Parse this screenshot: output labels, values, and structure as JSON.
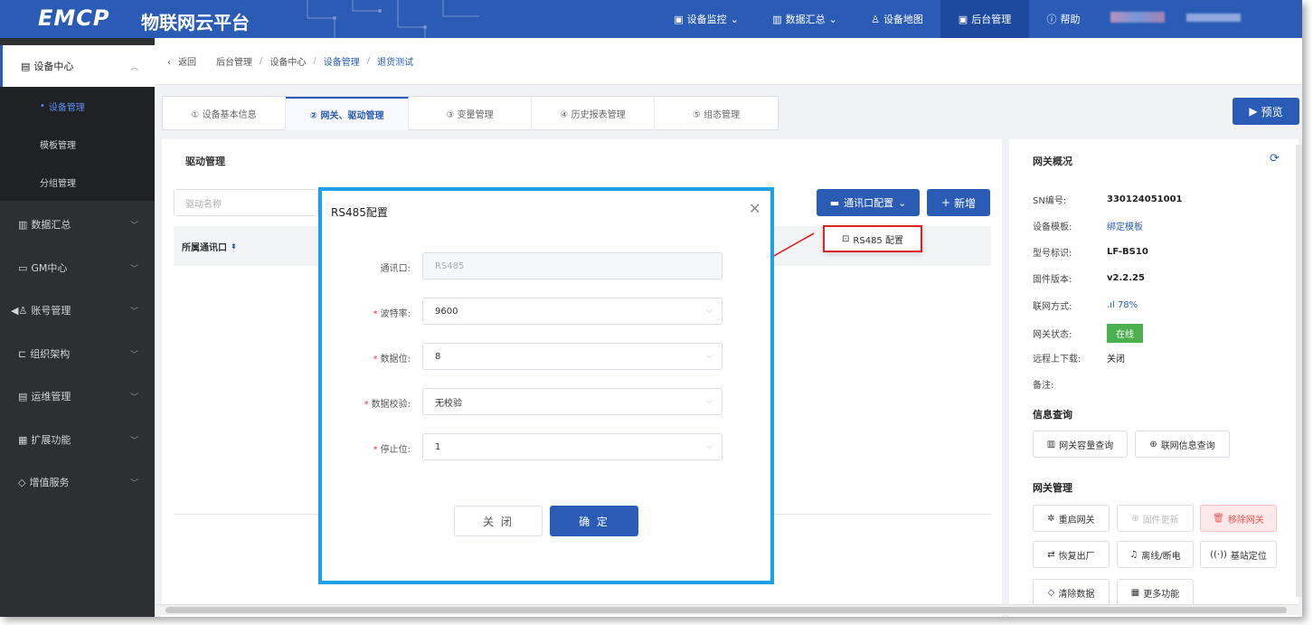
{
  "app": {
    "logo": "EMCP",
    "title": "物联网云平台"
  },
  "topnav": [
    {
      "label": "设备监控",
      "icon": "monitor-icon"
    },
    {
      "label": "数据汇总",
      "icon": "chart-icon"
    },
    {
      "label": "设备地图",
      "icon": "user-icon"
    },
    {
      "label": "后台管理",
      "icon": "monitor-icon",
      "active": true
    },
    {
      "label": "帮助",
      "icon": "help-icon"
    }
  ],
  "sidebar": {
    "device_center": "设备中心",
    "subs": [
      "设备管理",
      "模板管理",
      "分组管理"
    ],
    "groups": [
      "数据汇总",
      "GM中心",
      "账号管理",
      "组织架构",
      "运维管理",
      "扩展功能",
      "增值服务"
    ]
  },
  "breadcrumb": {
    "back": "返回",
    "items": [
      "后台管理",
      "设备中心",
      "设备管理",
      "退货测试"
    ]
  },
  "tabs": [
    "① 设备基本信息",
    "② 网关、驱动管理",
    "③ 变量管理",
    "④ 历史报表管理",
    "⑤ 组态管理"
  ],
  "preview_label": "预览",
  "driver": {
    "title": "驱动管理",
    "search_placeholder": "驱动名称",
    "col_port": "所属通讯口",
    "port_config_label": "通讯口配置",
    "new_label": "新增",
    "dropdown_item": "RS485 配置"
  },
  "gateway": {
    "title": "网关概况",
    "rows": [
      {
        "k": "SN编号:",
        "v": "330124051001"
      },
      {
        "k": "设备模板:",
        "v": "绑定模板"
      },
      {
        "k": "型号标识:",
        "v": "LF-BS10"
      },
      {
        "k": "固件版本:",
        "v": "v2.2.25"
      },
      {
        "k": "联网方式:",
        "v": "78%"
      },
      {
        "k": "网关状态:",
        "v": "在线"
      },
      {
        "k": "远程上下载:",
        "v": "关闭"
      },
      {
        "k": "备注:",
        "v": ""
      }
    ],
    "info_title": "信息查询",
    "info_buttons": [
      "网关容量查询",
      "联网信息查询"
    ],
    "mgmt_title": "网关管理",
    "mgmt_buttons": [
      "重启网关",
      "固件更新",
      "移除网关",
      "恢复出厂",
      "离线/断电",
      "基站定位",
      "清除数据",
      "更多功能"
    ]
  },
  "modal": {
    "title": "RS485配置",
    "fields": [
      {
        "label": "通讯口:",
        "value": "RS485",
        "required": false
      },
      {
        "label": "波特率:",
        "value": "9600",
        "required": true
      },
      {
        "label": "数据位:",
        "value": "8",
        "required": true
      },
      {
        "label": "数据校验:",
        "value": "无校验",
        "required": true
      },
      {
        "label": "停止位:",
        "value": "1",
        "required": true
      }
    ],
    "cancel_label": "关 闭",
    "ok_label": "确 定"
  },
  "colors": {
    "primary": "#2a5cb6",
    "modal_border": "#1aa1e6",
    "highlight": "#e02020",
    "online": "#4caf50"
  }
}
